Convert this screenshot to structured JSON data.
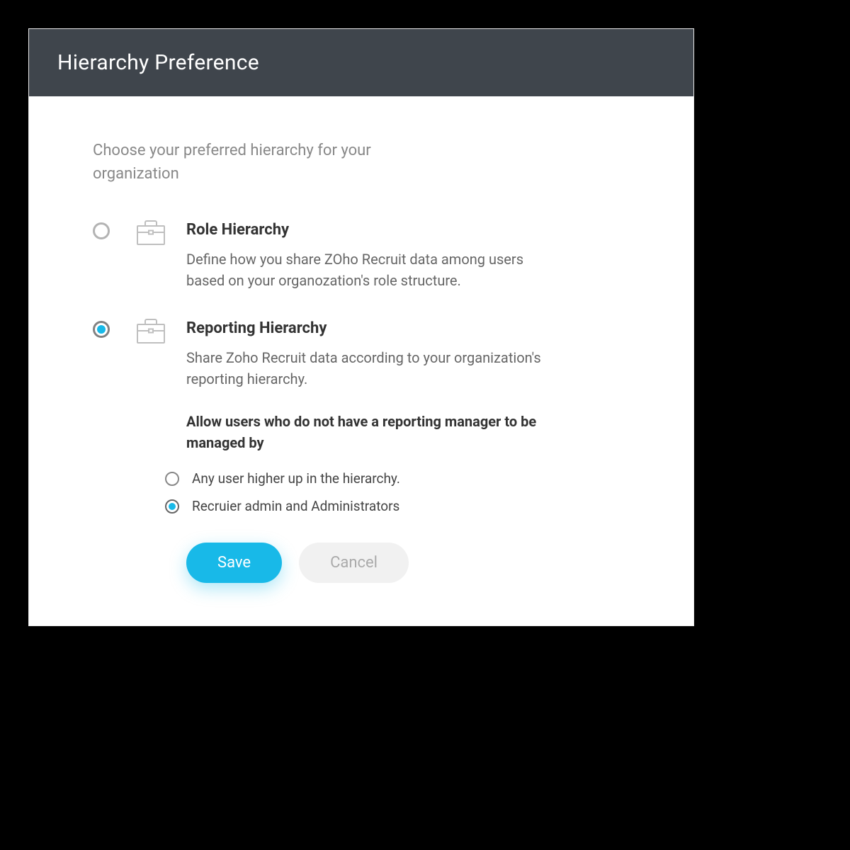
{
  "dialog": {
    "title": "Hierarchy Preference",
    "intro": "Choose your preferred hierarchy for your organization"
  },
  "options": {
    "role": {
      "title": "Role Hierarchy",
      "desc": "Define how you share ZOho Recruit data among users based on your organozation's role structure.",
      "selected": false
    },
    "reporting": {
      "title": "Reporting Hierarchy",
      "desc": "Share Zoho Recruit data according to your organization's reporting hierarchy.",
      "selected": true,
      "sub_heading": "Allow users who do not have a reporting manager to be managed by",
      "sub_options": [
        {
          "label": "Any user higher up in the hierarchy.",
          "selected": false
        },
        {
          "label": "Recruier admin and Administrators",
          "selected": true
        }
      ]
    }
  },
  "buttons": {
    "save": "Save",
    "cancel": "Cancel"
  },
  "colors": {
    "accent": "#18B9E8",
    "header_bg": "#3f454c"
  }
}
